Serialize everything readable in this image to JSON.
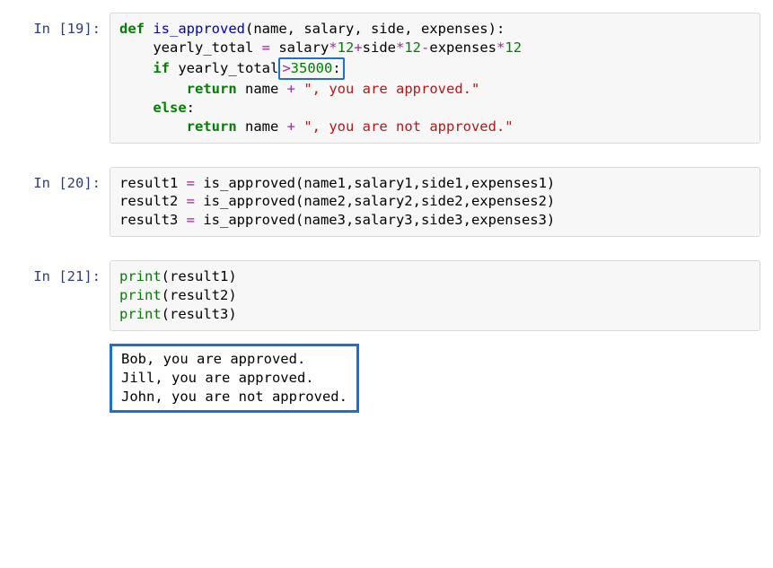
{
  "cells": {
    "c1": {
      "prompt": "In [19]:",
      "code": {
        "l1_def": "def",
        "l1_space": " ",
        "l1_fn": "is_approved",
        "l1_rest": "(name, salary, side, expenses):",
        "l2_a": "    yearly_total ",
        "l2_eq": "=",
        "l2_b": " salary",
        "l2_s1": "*",
        "l2_n1": "12",
        "l2_p1": "+",
        "l2_c": "side",
        "l2_s2": "*",
        "l2_n2": "12",
        "l2_m1": "-",
        "l2_d": "expenses",
        "l2_s3": "*",
        "l2_n3": "12",
        "l3_if": "    if",
        "l3_var": " yearly_total",
        "l3_gt": ">",
        "l3_num": "35000",
        "l3_colon": ":",
        "l4_ret": "        return",
        "l4_name": " name ",
        "l4_plus": "+",
        "l4_sp": " ",
        "l4_str": "\", you are approved.\"",
        "l5_else": "    else",
        "l5_colon": ":",
        "l6_ret": "        return",
        "l6_name": " name ",
        "l6_plus": "+",
        "l6_sp": " ",
        "l6_str": "\", you are not approved.\""
      }
    },
    "c2": {
      "prompt": "In [20]:",
      "code": {
        "l1a": "result1 ",
        "l1eq": "=",
        "l1b": " is_approved(name1,salary1,side1,expenses1)",
        "l2a": "result2 ",
        "l2eq": "=",
        "l2b": " is_approved(name2,salary2,side2,expenses2)",
        "l3a": "result3 ",
        "l3eq": "=",
        "l3b": " is_approved(name3,salary3,side3,expenses3)"
      }
    },
    "c3": {
      "prompt": "In [21]:",
      "code": {
        "l1p": "print",
        "l1r": "(result1)",
        "l2p": "print",
        "l2r": "(result2)",
        "l3p": "print",
        "l3r": "(result3)"
      },
      "output": {
        "l1": "Bob, you are approved.",
        "l2": "Jill, you are approved.",
        "l3": "John, you are not approved."
      }
    }
  }
}
